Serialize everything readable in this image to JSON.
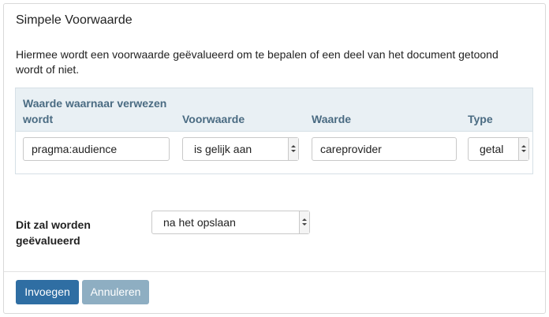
{
  "dialog": {
    "title": "Simpele Voorwaarde",
    "description": "Hiermee wordt een voorwaarde geëvalueerd om te bepalen of een deel van het document getoond wordt of niet."
  },
  "table": {
    "headers": [
      "Waarde waarnaar verwezen wordt",
      "Voorwaarde",
      "Waarde",
      "Type"
    ],
    "row": {
      "reference": "pragma:audience",
      "condition": "is gelijk aan",
      "value": "careprovider",
      "type": "getal"
    }
  },
  "evaluation": {
    "label": "Dit zal worden geëvalueerd",
    "selected": "na het opslaan"
  },
  "footer": {
    "insert_label": "Invoegen",
    "cancel_label": "Annuleren"
  },
  "colors": {
    "primary_button": "#2f6ea3",
    "secondary_button": "#8eaec2",
    "table_header_bg": "#e9f0f4",
    "table_header_text": "#4a6b82"
  }
}
